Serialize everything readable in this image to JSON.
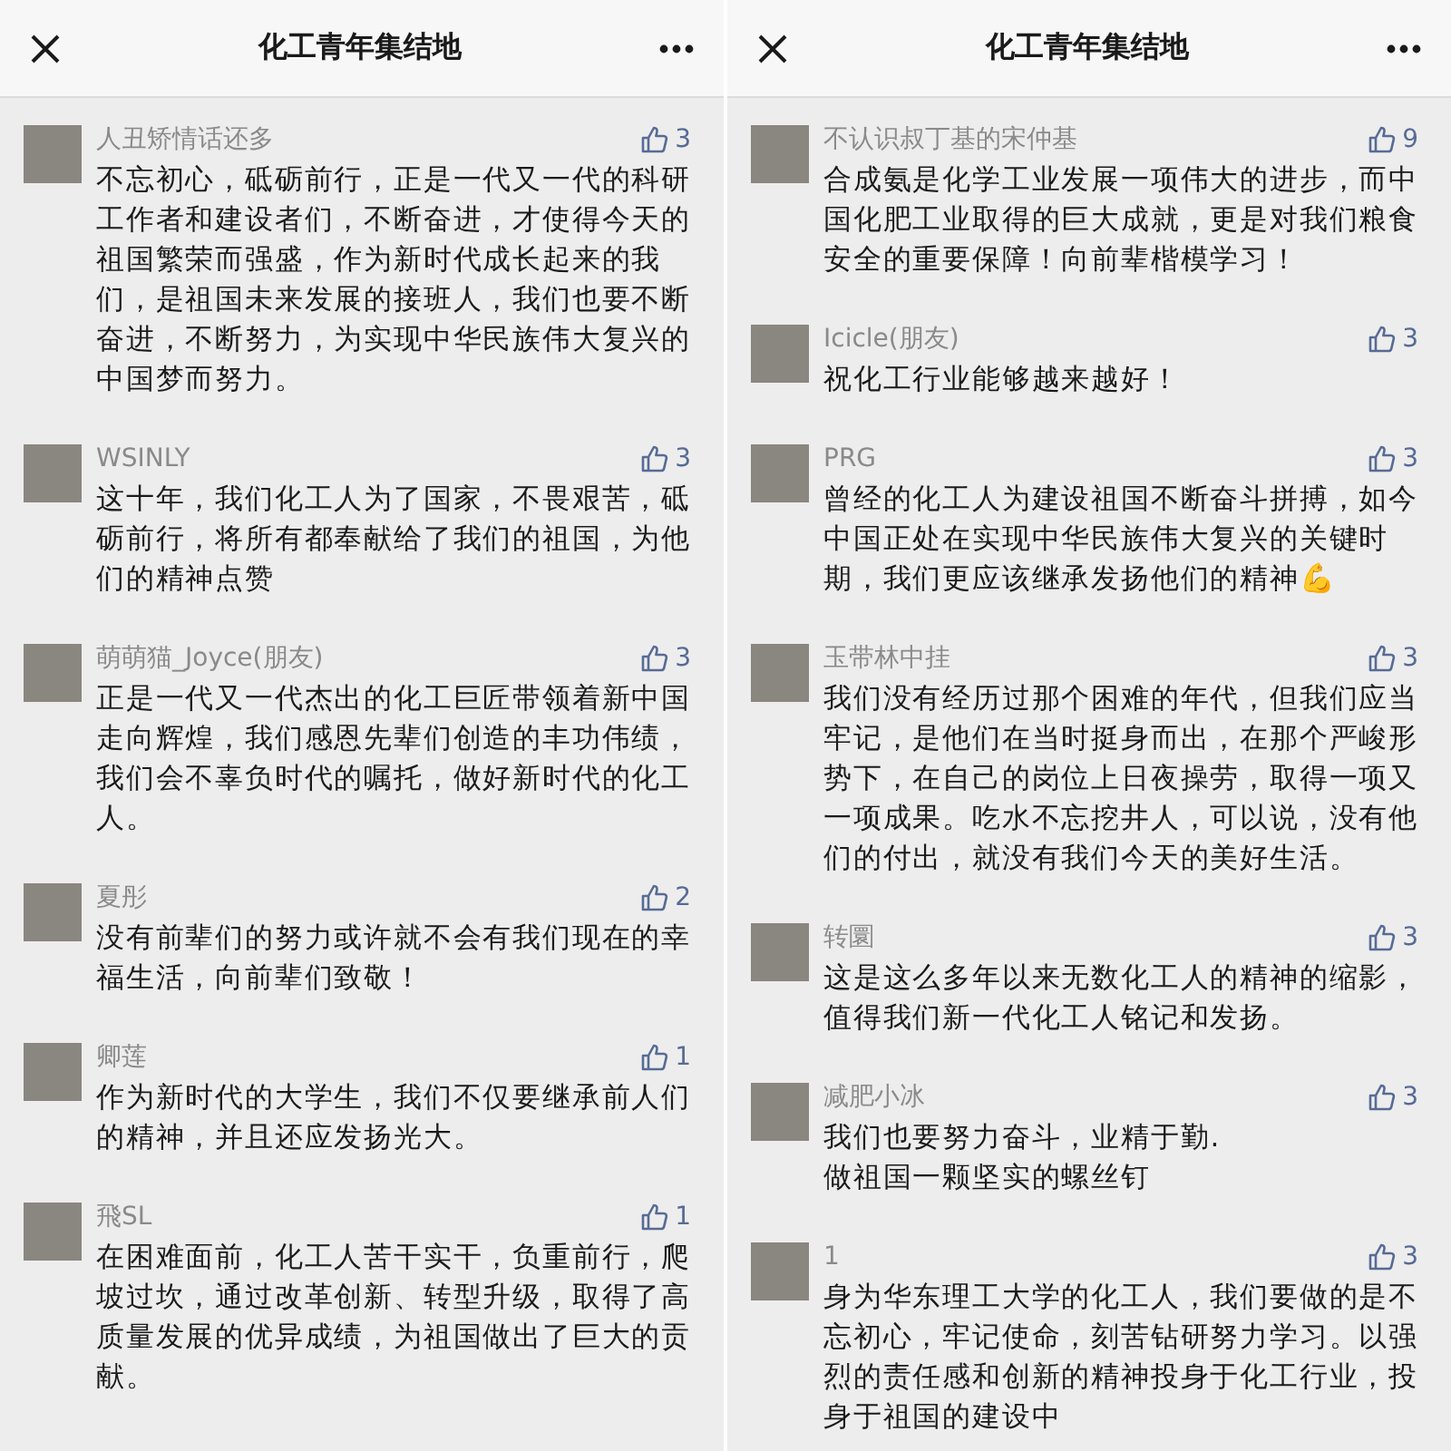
{
  "panels": [
    {
      "title": "化工青年集结地",
      "comments": [
        {
          "name": "人丑矫情话还多",
          "likes": "3",
          "text": "不忘初心，砥砺前行，正是一代又一代的科研工作者和建设者们，不断奋进，才使得今天的祖国繁荣而强盛，作为新时代成长起来的我们，是祖国未来发展的接班人，我们也要不断奋进，不断努力，为实现中华民族伟大复兴的中国梦而努力。"
        },
        {
          "name": "WSINLY",
          "likes": "3",
          "text": "这十年，我们化工人为了国家，不畏艰苦，砥砺前行，将所有都奉献给了我们的祖国，为他们的精神点赞"
        },
        {
          "name": "萌萌猫_Joyce(朋友)",
          "likes": "3",
          "text": "正是一代又一代杰出的化工巨匠带领着新中国走向辉煌，我们感恩先辈们创造的丰功伟绩，我们会不辜负时代的嘱托，做好新时代的化工人。"
        },
        {
          "name": "夏彤",
          "likes": "2",
          "text": "没有前辈们的努力或许就不会有我们现在的幸福生活，向前辈们致敬！"
        },
        {
          "name": "卿莲",
          "likes": "1",
          "text": "作为新时代的大学生，我们不仅要继承前人们的精神，并且还应发扬光大。"
        },
        {
          "name": "飛SL",
          "likes": "1",
          "text": "在困难面前，化工人苦干实干，负重前行，爬坡过坎，通过改革创新、转型升级，取得了高质量发展的优异成绩，为祖国做出了巨大的贡献。"
        }
      ]
    },
    {
      "title": "化工青年集结地",
      "comments": [
        {
          "name": "不认识叔丁基的宋仲基",
          "likes": "9",
          "text": "合成氨是化学工业发展一项伟大的进步，而中国化肥工业取得的巨大成就，更是对我们粮食安全的重要保障！向前辈楷模学习！"
        },
        {
          "name": "Icicle(朋友)",
          "likes": "3",
          "text": "祝化工行业能够越来越好！"
        },
        {
          "name": "PRG",
          "likes": "3",
          "text": "曾经的化工人为建设祖国不断奋斗拼搏，如今中国正处在实现中华民族伟大复兴的关键时期，我们更应该继承发扬他们的精神💪"
        },
        {
          "name": "玉带林中挂",
          "likes": "3",
          "text": "我们没有经历过那个困难的年代，但我们应当牢记，是他们在当时挺身而出，在那个严峻形势下，在自己的岗位上日夜操劳，取得一项又一项成果。吃水不忘挖井人，可以说，没有他们的付出，就没有我们今天的美好生活。"
        },
        {
          "name": "转圜",
          "likes": "3",
          "text": "这是这么多年以来无数化工人的精神的缩影，值得我们新一代化工人铭记和发扬。"
        },
        {
          "name": "减肥小冰",
          "likes": "3",
          "text": "我们也要努力奋斗，业精于勤.\n做祖国一颗坚实的螺丝钉"
        },
        {
          "name": "1",
          "likes": "3",
          "text": "身为华东理工大学的化工人，我们要做的是不忘初心，牢记使命，刻苦钻研努力学习。以强烈的责任感和创新的精神投身于化工行业，投身于祖国的建设中"
        }
      ]
    }
  ]
}
